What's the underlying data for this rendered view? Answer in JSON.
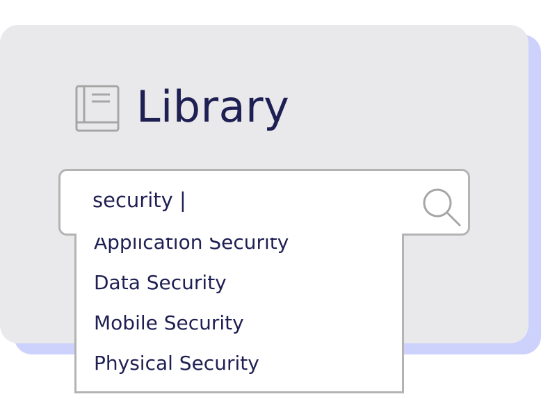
{
  "header": {
    "title": "Library",
    "icon": "book-icon"
  },
  "search": {
    "value": "security |",
    "icon": "search-icon"
  },
  "suggestions": [
    {
      "label": "Application Security"
    },
    {
      "label": "Data Security"
    },
    {
      "label": "Mobile Security"
    },
    {
      "label": "Physical Security"
    }
  ],
  "colors": {
    "card_background": "#e9e9eb",
    "card_shadow": "#ccd2fb",
    "text": "#1e1f52",
    "border": "#b3b3b3",
    "icon": "#a6a6a6"
  }
}
